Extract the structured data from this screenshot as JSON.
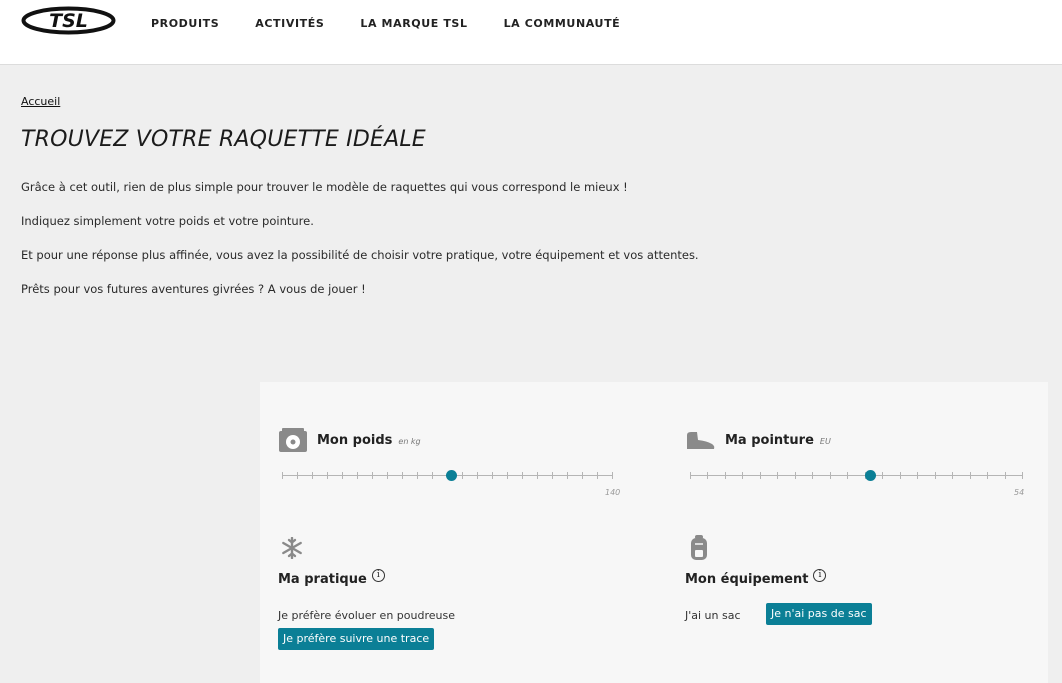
{
  "header": {
    "logo_text": "TSL",
    "nav": [
      "PRODUITS",
      "ACTIVITÉS",
      "LA MARQUE TSL",
      "LA COMMUNAUTÉ"
    ]
  },
  "breadcrumb": "Accueil",
  "title": "TROUVEZ VOTRE RAQUETTE IDÉALE",
  "intro": [
    "Grâce à cet outil, rien de plus simple pour trouver le modèle de raquettes qui vous correspond le mieux !",
    "Indiquez simplement votre poids et votre pointure.",
    "Et pour une réponse plus affinée, vous avez la possibilité de choisir votre pratique, votre équipement et vos attentes.",
    "Prêts pour vos futures aventures givrées ? A vous de jouer !"
  ],
  "weight": {
    "title": "Mon poids",
    "unit": "en kg",
    "max_label": "140",
    "position": 0.51
  },
  "shoe": {
    "title": "Ma pointure",
    "unit": "EU",
    "max_label": "54",
    "position": 0.54
  },
  "practice": {
    "title": "Ma pratique",
    "info": "i",
    "option_1": "Je préfère évoluer en poudreuse",
    "option_2": "Je préfère suivre une trace"
  },
  "equipment": {
    "title": "Mon équipement",
    "info": "i",
    "option_1": "J'ai un sac",
    "option_2": "Je n'ai pas de sac"
  },
  "colors": {
    "accent": "#0b7f96",
    "background": "#efefef",
    "panel": "#f7f7f7"
  }
}
